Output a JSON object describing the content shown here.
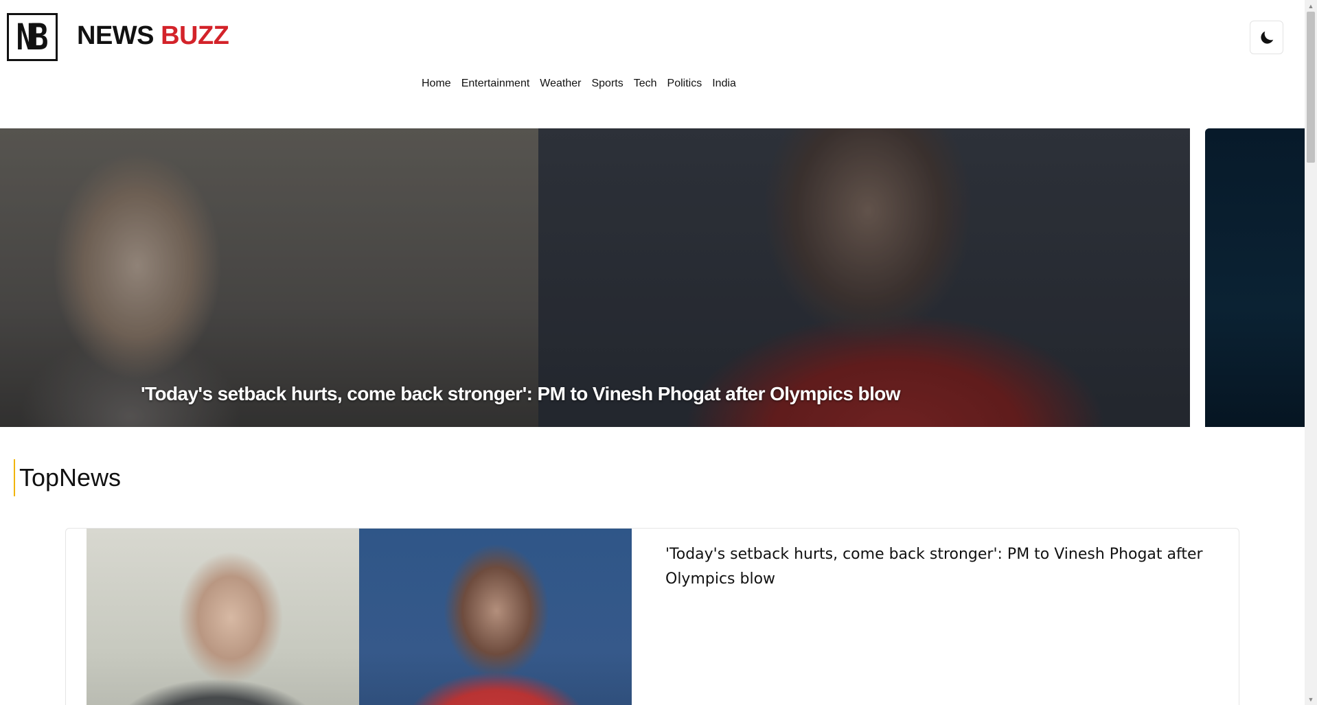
{
  "header": {
    "logo_text": "NB",
    "brand_word1": "NEWS",
    "brand_word2": "BUZZ",
    "theme_icon": "moon-icon"
  },
  "nav": {
    "items": [
      {
        "label": "Home",
        "active": true
      },
      {
        "label": "Entertainment",
        "active": false
      },
      {
        "label": "Weather",
        "active": false
      },
      {
        "label": "Sports",
        "active": false
      },
      {
        "label": "Tech",
        "active": false
      },
      {
        "label": "Politics",
        "active": false
      },
      {
        "label": "India",
        "active": false
      }
    ]
  },
  "carousel": {
    "slides": [
      {
        "title": "'Today's setback hurts, come back stronger': PM to Vinesh Phogat after Olympics blow"
      }
    ]
  },
  "top_news": {
    "section_title": "TopNews",
    "articles": [
      {
        "title": "'Today's setback hurts, come back stronger': PM to Vinesh Phogat after Olympics blow"
      }
    ]
  },
  "colors": {
    "brand_red": "#d3232a",
    "nav_active": "#e0403a",
    "section_accent": "#f1b400"
  }
}
